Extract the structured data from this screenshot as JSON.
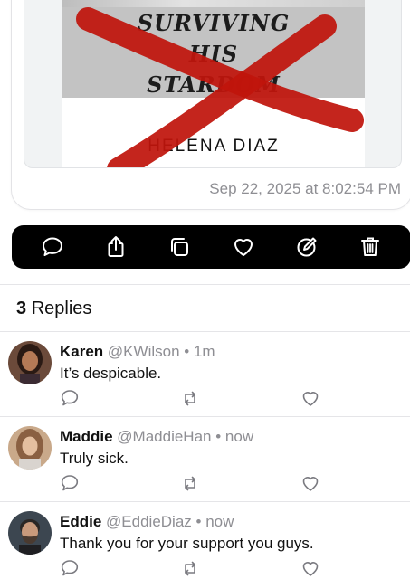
{
  "post": {
    "book_cover": {
      "title": "SURVIVING\nHIS\nSTARDOM",
      "author": "HELENA DIAZ"
    },
    "timestamp": "Sep 22, 2025 at 8:02:54 PM"
  },
  "action_bar": {
    "icons": [
      "comment-icon",
      "share-icon",
      "copy-icon",
      "heart-icon",
      "edit-icon",
      "trash-icon"
    ],
    "background": "#000000"
  },
  "replies_header": {
    "count": "3",
    "label": "Replies"
  },
  "replies": [
    {
      "name": "Karen",
      "handle": "@KWilson",
      "dot": "•",
      "time": "1m",
      "text": "It’s despicable."
    },
    {
      "name": "Maddie",
      "handle": "@MaddieHan",
      "dot": "•",
      "time": "now",
      "text": "Truly sick."
    },
    {
      "name": "Eddie",
      "handle": "@EddieDiaz",
      "dot": "•",
      "time": "now",
      "text": "Thank you for your support you guys."
    }
  ],
  "colors": {
    "cross_red": "#c0140c",
    "secondary_text": "#8e8e93",
    "reply_icon": "#7a7a80"
  }
}
